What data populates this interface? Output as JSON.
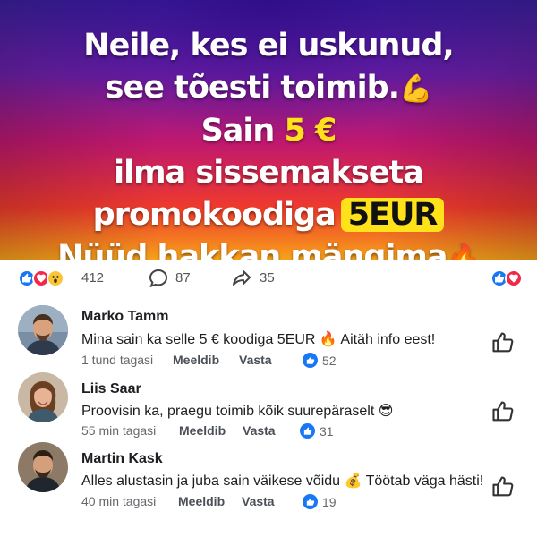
{
  "banner": {
    "line1": "Neile, kes ei uskunud,",
    "line2": "see tõesti toimib.",
    "line2_emoji": "💪",
    "line3_prefix": "Sain ",
    "line3_amount": "5 €",
    "line4": "ilma sissemakseta",
    "line5": "promokoodiga",
    "line5_code": "5EUR",
    "line6": "Nüüd hakkan mängima",
    "line6_emoji": "🔥"
  },
  "reactions": {
    "count": "412",
    "comments": "87",
    "shares": "35",
    "icons": [
      "like-icon",
      "love-icon",
      "wow-icon"
    ]
  },
  "comments": [
    {
      "name": "Marko Tamm",
      "text": "Mina sain ka selle 5 € koodiga 5EUR 🔥 Aitäh info eest!",
      "time": "1 tund tagasi",
      "like_label": "Meeldib",
      "reply_label": "Vasta",
      "likes": "52"
    },
    {
      "name": "Liis Saar",
      "text": "Proovisin ka, praegu toimib kõik suurepäraselt 😎",
      "time": "55 min tagasi",
      "like_label": "Meeldib",
      "reply_label": "Vasta",
      "likes": "31"
    },
    {
      "name": "Martin Kask",
      "text": "Alles alustasin ja juba sain väikese võidu 💰 Töötab väga hästi!",
      "time": "40 min tagasi",
      "like_label": "Meeldib",
      "reply_label": "Vasta",
      "likes": "19"
    }
  ],
  "colors": {
    "facebook_blue": "#1877f2",
    "love_red": "#f0284a",
    "highlight_yellow": "#ffe21a"
  }
}
